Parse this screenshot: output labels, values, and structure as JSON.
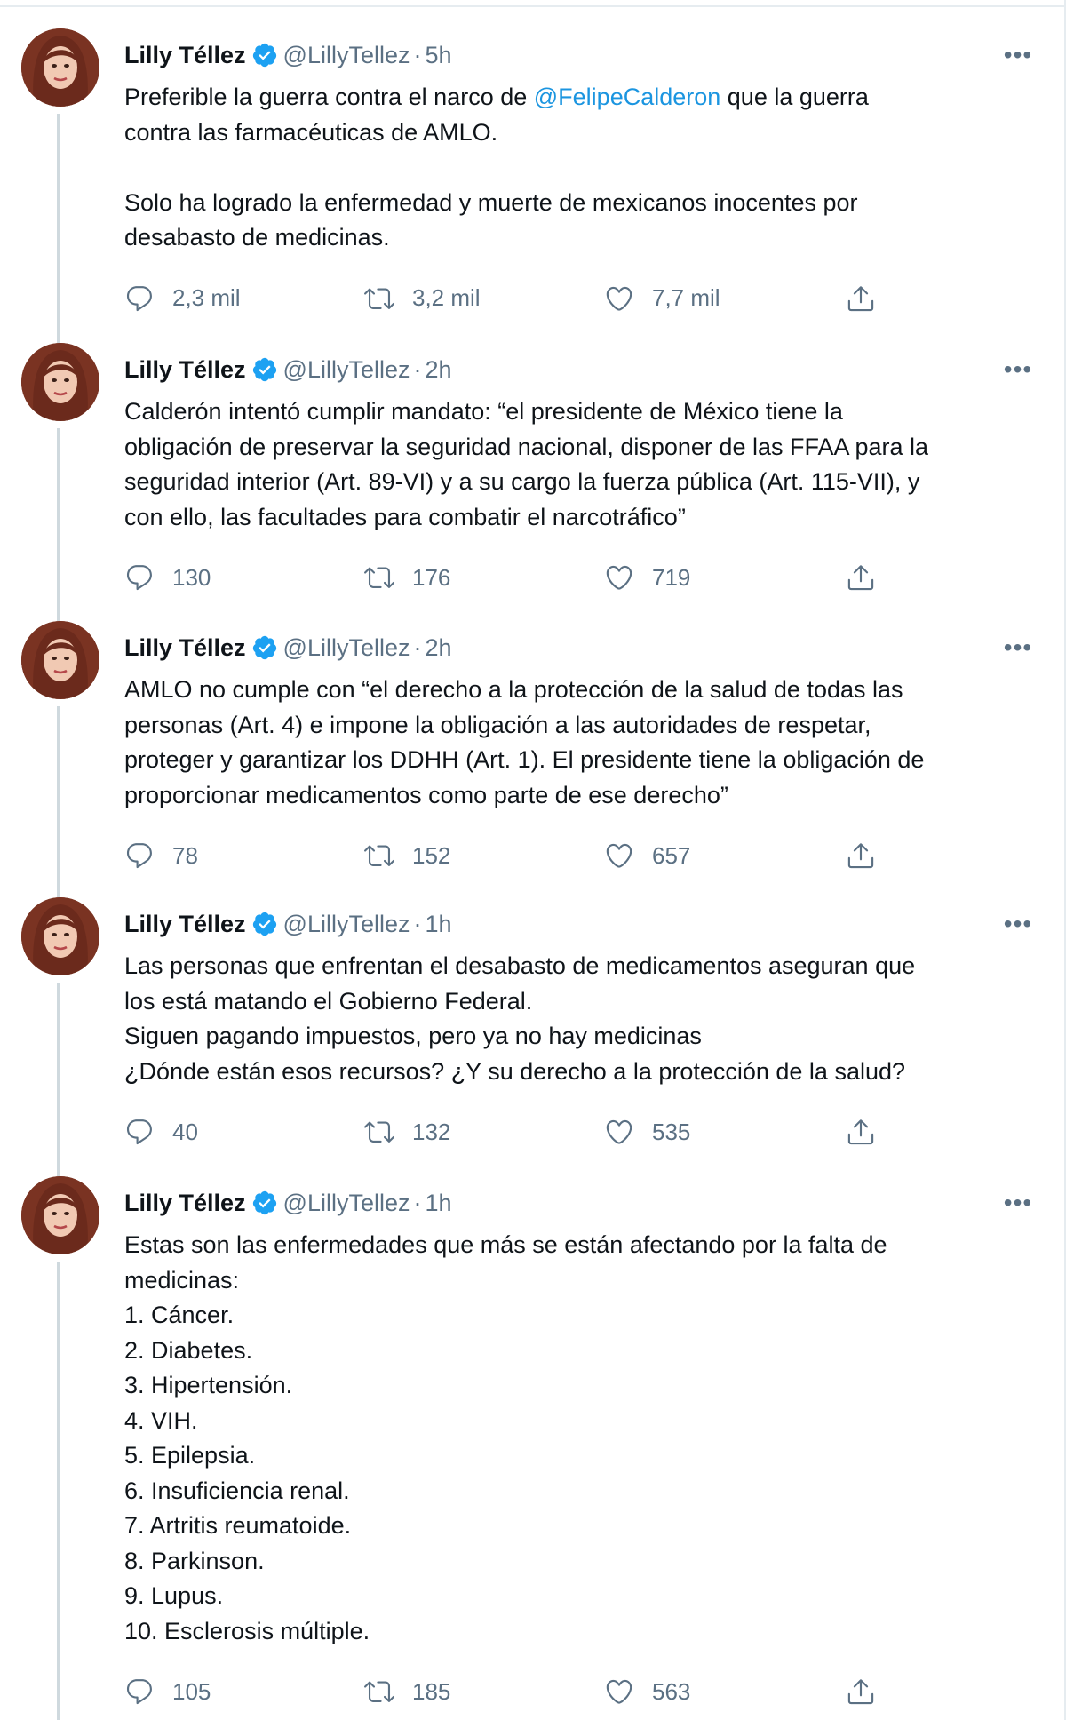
{
  "tweets": [
    {
      "name": "Lilly Téllez",
      "handle": "@LillyTellez",
      "time": "5h",
      "text_before": "Preferible la guerra contra el narco de ",
      "mention": "@FelipeCalderon",
      "text_after": " que la guerra\ncontra las farmacéuticas de AMLO.\n\nSolo ha logrado la enfermedad y muerte de mexicanos inocentes por\ndesabasto de medicinas.",
      "replies": "2,3 mil",
      "retweets": "3,2 mil",
      "likes": "7,7 mil"
    },
    {
      "name": "Lilly Téllez",
      "handle": "@LillyTellez",
      "time": "2h",
      "text": "Calderón intentó cumplir mandato: “el presidente de México tiene la\nobligación de preservar la seguridad nacional, disponer de las FFAA para la\nseguridad interior (Art. 89-VI) y a su cargo la fuerza pública (Art. 115-VII), y\ncon ello, las facultades para combatir el narcotráfico”",
      "replies": "130",
      "retweets": "176",
      "likes": "719"
    },
    {
      "name": "Lilly Téllez",
      "handle": "@LillyTellez",
      "time": "2h",
      "text": "AMLO no cumple con “el derecho a la protección de la salud de todas las\npersonas (Art. 4) e impone la obligación a las autoridades de respetar,\nproteger y garantizar los DDHH (Art. 1). El presidente tiene la obligación de\nproporcionar medicamentos como parte de ese derecho”",
      "replies": "78",
      "retweets": "152",
      "likes": "657"
    },
    {
      "name": "Lilly Téllez",
      "handle": "@LillyTellez",
      "time": "1h",
      "text": "Las personas que enfrentan el desabasto de medicamentos aseguran que\nlos está matando el Gobierno Federal.\nSiguen pagando impuestos, pero ya no hay medicinas\n¿Dónde están esos recursos? ¿Y su derecho a la protección de la salud?",
      "replies": "40",
      "retweets": "132",
      "likes": "535"
    },
    {
      "name": "Lilly Téllez",
      "handle": "@LillyTellez",
      "time": "1h",
      "text": "Estas son las enfermedades que más se están afectando por la falta de\nmedicinas:\n1. Cáncer.\n2. Diabetes.\n3. Hipertensión.\n4. VIH.\n5. Epilepsia.\n6. Insuficiencia renal.\n7. Artritis reumatoide.\n8. Parkinson.\n9. Lupus.\n10. Esclerosis múltiple.",
      "replies": "105",
      "retweets": "185",
      "likes": "563"
    }
  ],
  "icons": {
    "reply": "reply-icon",
    "retweet": "retweet-icon",
    "like": "like-icon",
    "share": "share-icon",
    "more": "more-icon",
    "verified": "verified-badge-icon"
  },
  "colors": {
    "text": "#0f1419",
    "secondary": "#5b7083",
    "mention": "#1b95e0",
    "verified": "#1da1f2",
    "thread_line": "#cfd9de"
  },
  "more_label": "•••",
  "separator": "·"
}
